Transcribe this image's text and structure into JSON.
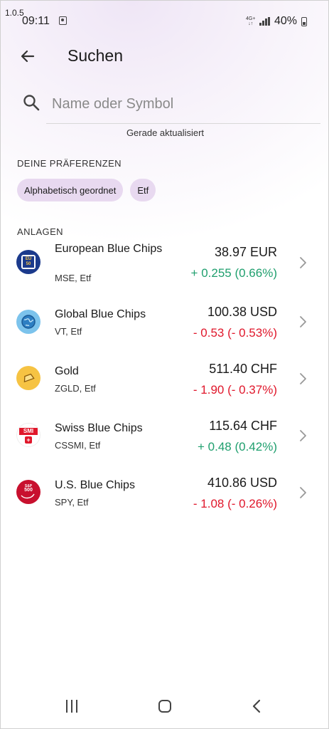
{
  "status_bar": {
    "version": "1.0.5",
    "time": "09:11",
    "network": "4G+",
    "battery": "40%"
  },
  "header": {
    "title": "Suchen",
    "back_icon": "arrow-left-icon"
  },
  "search": {
    "placeholder": "Name oder Symbol",
    "value": "",
    "icon": "search-icon",
    "status": "Gerade aktualisiert"
  },
  "preferences": {
    "heading": "DEINE PRÄFERENZEN",
    "chips": [
      {
        "label": "Alphabetisch geordnet"
      },
      {
        "label": "Etf"
      }
    ]
  },
  "assets": {
    "heading": "ANLAGEN",
    "items": [
      {
        "name": "European Blue Chips",
        "sub": "MSE, Etf",
        "price": "38.97 EUR",
        "change": "+ 0.255 (0.66%)",
        "direction": "up",
        "logo_text": "EURO 50",
        "logo_color": "#1b3a8c"
      },
      {
        "name": "Global Blue Chips",
        "sub": "VT, Etf",
        "price": "100.38 USD",
        "change": "- 0.53 (- 0.53%)",
        "direction": "down",
        "logo_icon": "globe-icon",
        "logo_color": "#7cc3ec"
      },
      {
        "name": "Gold",
        "sub": "ZGLD, Etf",
        "price": "511.40 CHF",
        "change": "- 1.90 (- 0.37%)",
        "direction": "down",
        "logo_icon": "gold-bar-icon",
        "logo_color": "#f6c343"
      },
      {
        "name": "Swiss Blue Chips",
        "sub": "CSSMI, Etf",
        "price": "115.64 CHF",
        "change": "+ 0.48 (0.42%)",
        "direction": "up",
        "logo_text": "SMI",
        "logo_color": "#e0172b"
      },
      {
        "name": "U.S. Blue Chips",
        "sub": "SPY, Etf",
        "price": "410.86 USD",
        "change": "- 1.08 (- 0.26%)",
        "direction": "down",
        "logo_text": "S&P 500",
        "logo_color": "#c8102e"
      }
    ]
  },
  "colors": {
    "positive": "#1f9f6e",
    "negative": "#e0172b",
    "chip_bg": "#e8d9f0"
  }
}
